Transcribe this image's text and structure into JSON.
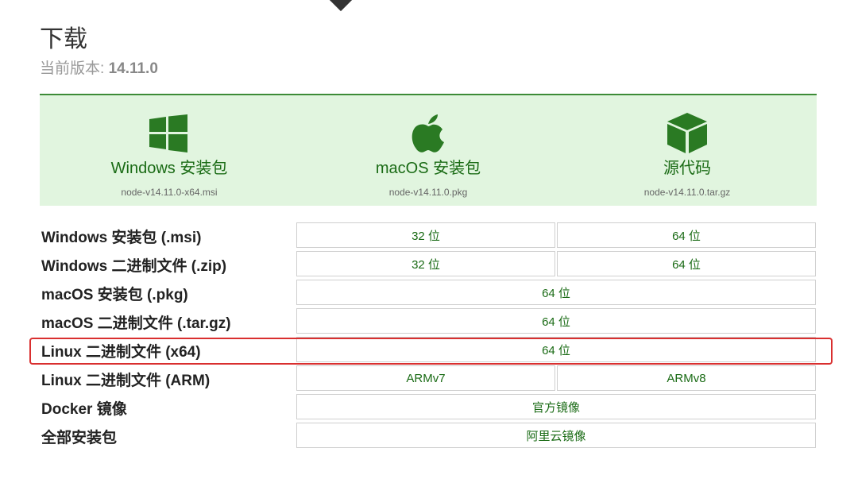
{
  "title": "下载",
  "version": {
    "label": "当前版本: ",
    "value": "14.11.0"
  },
  "hero": [
    {
      "icon": "windows-logo-icon",
      "label": "Windows 安装包",
      "file": "node-v14.11.0-x64.msi"
    },
    {
      "icon": "apple-logo-icon",
      "label": "macOS 安装包",
      "file": "node-v14.11.0.pkg"
    },
    {
      "icon": "source-cube-icon",
      "label": "源代码",
      "file": "node-v14.11.0.tar.gz"
    }
  ],
  "rows": [
    {
      "label": "Windows 安装包 (.msi)",
      "cells": [
        "32 位",
        "64 位"
      ]
    },
    {
      "label": "Windows 二进制文件 (.zip)",
      "cells": [
        "32 位",
        "64 位"
      ]
    },
    {
      "label": "macOS 安装包 (.pkg)",
      "cells": [
        "64 位"
      ]
    },
    {
      "label": "macOS 二进制文件 (.tar.gz)",
      "cells": [
        "64 位"
      ]
    },
    {
      "label": "Linux 二进制文件 (x64)",
      "cells": [
        "64 位"
      ],
      "highlighted": true
    },
    {
      "label": "Linux 二进制文件 (ARM)",
      "cells": [
        "ARMv7",
        "ARMv8"
      ]
    },
    {
      "label": "Docker 镜像",
      "cells": [
        "官方镜像"
      ]
    },
    {
      "label": "全部安装包",
      "cells": [
        "阿里云镜像"
      ]
    }
  ],
  "colors": {
    "accent": "#1a6b15",
    "hero_bg": "#e1f5df",
    "highlight": "#d92f2f"
  }
}
